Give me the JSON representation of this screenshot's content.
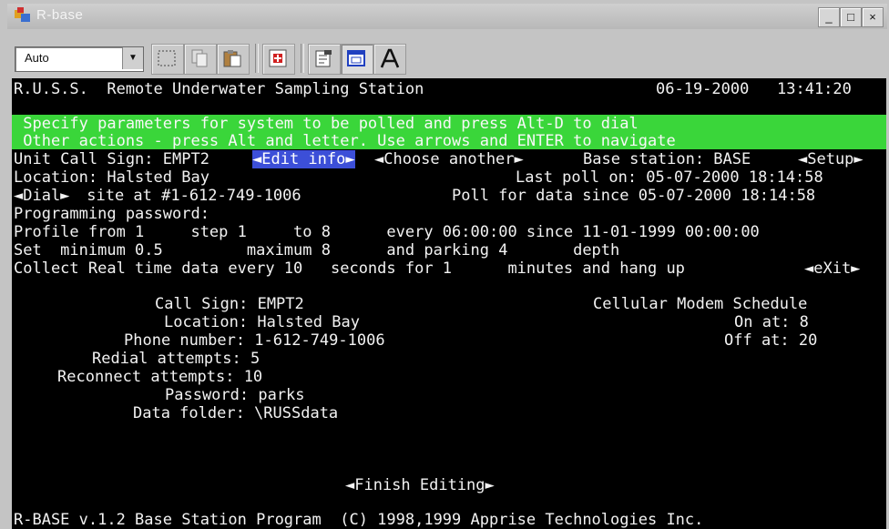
{
  "window": {
    "title": "R-base",
    "controls": {
      "minimize": "_",
      "maximize": "□",
      "close": "×"
    }
  },
  "toolbar": {
    "font_select_value": "Auto",
    "buttons": [
      "mark-icon",
      "copy-icon",
      "paste-icon",
      "fullscreen-icon",
      "properties-icon",
      "background-icon",
      "font-icon"
    ]
  },
  "console": {
    "header": {
      "app_title": "R.U.S.S.  Remote Underwater Sampling Station",
      "date": "06-19-2000",
      "time": "13:41:20"
    },
    "banner": {
      "line1": " Specify parameters for system to be polled and press Alt-D to dial",
      "line2": " Other actions - press Alt and letter. Use arrows and ENTER to navigate"
    },
    "unit": {
      "label": "Unit Call Sign: EMPT2 ",
      "edit_info": "◄Edit info►",
      "choose_another": "◄Choose another►",
      "base_station": "Base station: BASE",
      "setup": "◄Setup►"
    },
    "location_line": {
      "label": "Location: Halsted Bay",
      "last_poll": "Last poll on: 05-07-2000 18:14:58"
    },
    "dial_line": {
      "dial": "◄Dial►",
      "site": " site at #1-612-749-1006",
      "poll": "Poll for data since 05-07-2000 18:14:58"
    },
    "password_line": "Programming password:",
    "profile_line": "Profile from 1     step 1     to 8      every 06:00:00 since 11-01-1999 00:00:00",
    "set_line": "Set  minimum 0.5         maximum 8      and parking 4       depth",
    "collect_line": {
      "text": "Collect Real time data every 10   seconds for 1      minutes and hang up",
      "exit": "◄eXit►"
    },
    "details": {
      "call_sign": "Call Sign: EMPT2",
      "location": "Location: Halsted Bay",
      "phone": "Phone number: 1-612-749-1006",
      "redial": "Redial attempts: 5",
      "reconnect": "Reconnect attempts: 10",
      "password": "Password: parks",
      "folder": "Data folder: \\RUSSdata"
    },
    "schedule": {
      "title": "Cellular Modem Schedule",
      "on": "On at: 8",
      "off": "Off at: 20"
    },
    "finish_button": "◄Finish Editing►",
    "footer": "R-BASE v.1.2 Base Station Program  (C) 1998,1999 Apprise Technologies Inc."
  }
}
